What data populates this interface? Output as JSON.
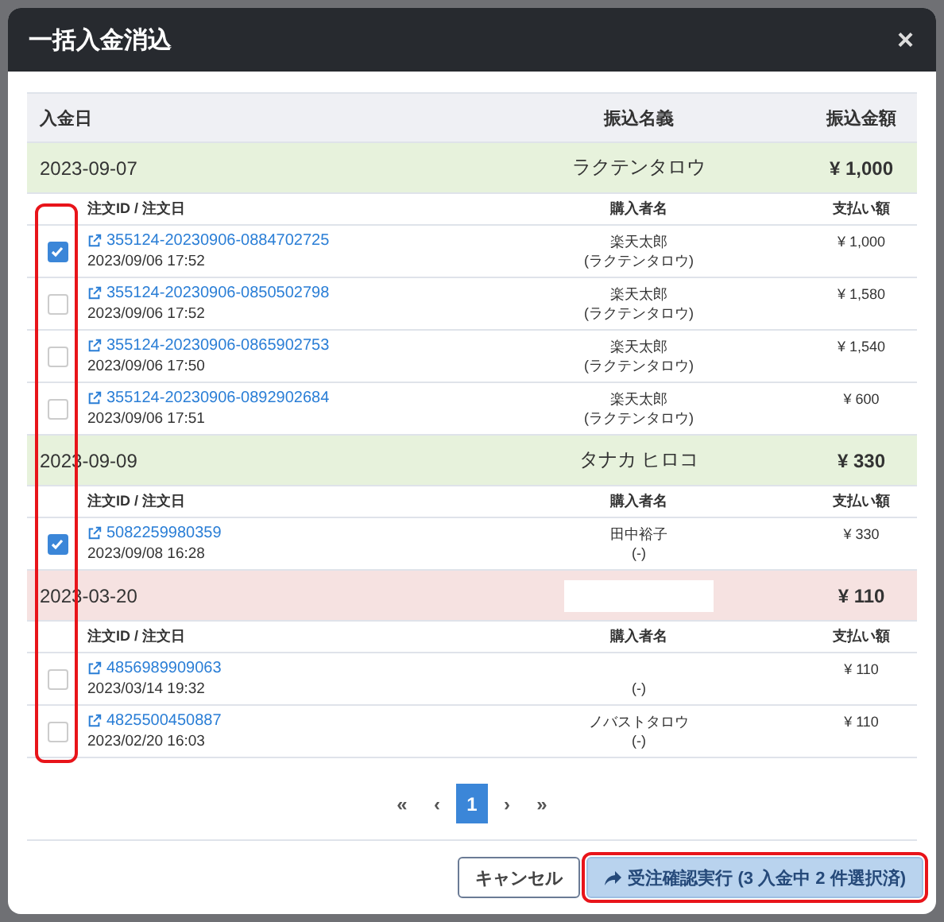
{
  "dialog": {
    "title": "一括入金消込",
    "close": "×"
  },
  "table": {
    "columns": [
      "入金日",
      "振込名義",
      "振込金額"
    ],
    "checkbox_highlight": true,
    "groups": [
      {
        "date": "2023-09-07",
        "name": "ラクテンタロウ",
        "redacted": false,
        "amount": "¥ 1,000",
        "color": "#e7f2dc",
        "columns": [
          "注文ID / 注文日",
          "購入者名",
          "支払い額"
        ],
        "orders": [
          {
            "id": "355124-20230906-0884702725",
            "date": "2023/09/06 17:52",
            "buyer_name": "楽天太郎",
            "buyer_kana": "(ラクテンタロウ)",
            "amount": "¥ 1,000",
            "checked": true
          },
          {
            "id": "355124-20230906-0850502798",
            "date": "2023/09/06 17:52",
            "buyer_name": "楽天太郎",
            "buyer_kana": "(ラクテンタロウ)",
            "amount": "¥ 1,580",
            "checked": false
          },
          {
            "id": "355124-20230906-0865902753",
            "date": "2023/09/06 17:50",
            "buyer_name": "楽天太郎",
            "buyer_kana": "(ラクテンタロウ)",
            "amount": "¥ 1,540",
            "checked": false
          },
          {
            "id": "355124-20230906-0892902684",
            "date": "2023/09/06 17:51",
            "buyer_name": "楽天太郎",
            "buyer_kana": "(ラクテンタロウ)",
            "amount": "¥ 600",
            "checked": false
          }
        ]
      },
      {
        "date": "2023-09-09",
        "name": "タナカ ヒロコ",
        "redacted": false,
        "amount": "¥ 330",
        "color": "#e7f2dc",
        "columns": [
          "注文ID / 注文日",
          "購入者名",
          "支払い額"
        ],
        "orders": [
          {
            "id": "5082259980359",
            "date": "2023/09/08 16:28",
            "buyer_name": "田中裕子",
            "buyer_kana": "(-)",
            "amount": "¥ 330",
            "checked": true
          }
        ]
      },
      {
        "date": "2023-03-20",
        "redacted": true,
        "amount": "¥ 110",
        "color": "#f6e2e1",
        "columns": [
          "注文ID / 注文日",
          "購入者名",
          "支払い額"
        ],
        "orders": [
          {
            "id": "4856989909063",
            "date": "2023/03/14 19:32",
            "buyer_kana": "(-)",
            "amount": "¥ 110",
            "checked": false
          },
          {
            "id": "4825500450887",
            "date": "2023/02/20 16:03",
            "buyer_name": "ノバストタロウ",
            "buyer_kana": "(-)",
            "amount": "¥ 110",
            "checked": false
          }
        ]
      }
    ]
  },
  "pagination": [
    {
      "label": "«",
      "selected": false
    },
    {
      "label": "‹",
      "selected": false
    },
    {
      "label": "1",
      "selected": true
    },
    {
      "label": "›",
      "selected": false
    },
    {
      "label": "»",
      "selected": false
    }
  ],
  "footer": {
    "cancel": "キャンセル",
    "submit": "受注確認実行 (3 入金中 2 件選択済)",
    "submit_highlighted": true
  }
}
